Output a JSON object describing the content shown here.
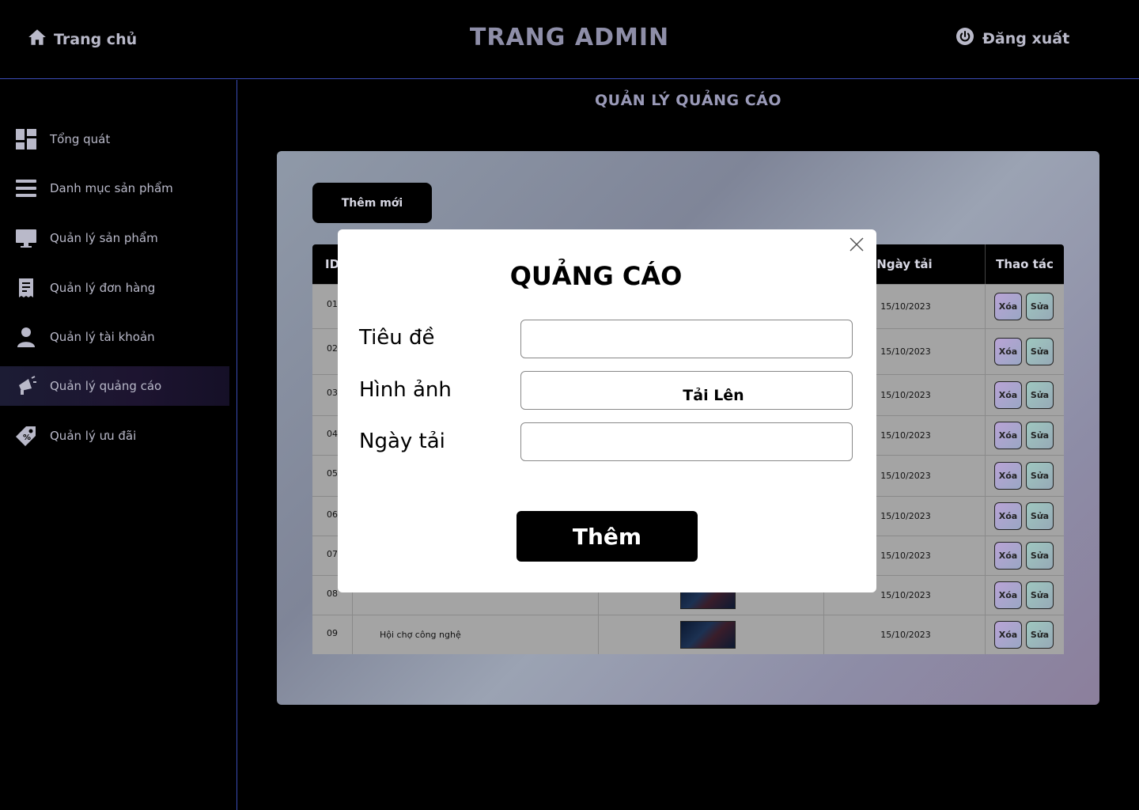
{
  "header": {
    "home_label": "Trang chủ",
    "title": "TRANG ADMIN",
    "logout_label": "Đăng xuất"
  },
  "sidebar": {
    "items": [
      {
        "label": "Tổng quát",
        "icon": "dashboard-icon"
      },
      {
        "label": "Danh mục sản phẩm",
        "icon": "menu-lines-icon"
      },
      {
        "label": "Quản lý sản phẩm",
        "icon": "monitor-icon"
      },
      {
        "label": "Quản lý đơn hàng",
        "icon": "receipt-icon"
      },
      {
        "label": "Quản lý tài khoản",
        "icon": "user-icon"
      },
      {
        "label": "Quản lý quảng cáo",
        "icon": "megaphone-icon",
        "active": true
      },
      {
        "label": "Quản lý ưu đãi",
        "icon": "tag-icon"
      }
    ]
  },
  "main": {
    "section_title": "QUẢN LÝ QUẢNG CÁO",
    "add_new_label": "Thêm mới",
    "table": {
      "headers": [
        "ID",
        "Ngày tải",
        "Thao tác"
      ],
      "delete_label": "Xóa",
      "edit_label": "Sửa",
      "rows": [
        {
          "id": "01",
          "title": "",
          "date": "15/10/2023"
        },
        {
          "id": "02",
          "title": "",
          "date": "15/10/2023"
        },
        {
          "id": "03",
          "title": "",
          "date": "15/10/2023"
        },
        {
          "id": "04",
          "title": "",
          "date": "15/10/2023"
        },
        {
          "id": "05",
          "title": "",
          "date": "15/10/2023"
        },
        {
          "id": "06",
          "title": "",
          "date": "15/10/2023"
        },
        {
          "id": "07",
          "title": "",
          "date": "15/10/2023"
        },
        {
          "id": "08",
          "title": "",
          "date": "15/10/2023"
        },
        {
          "id": "09",
          "title": "Hội chợ công nghệ",
          "date": "15/10/2023"
        }
      ]
    }
  },
  "modal": {
    "title": "QUẢNG CÁO",
    "fields": {
      "title_label": "Tiêu đề",
      "title_value": "",
      "image_label": "Hình ảnh",
      "upload_label": "Tải Lên",
      "date_label": "Ngày tải",
      "date_value": ""
    },
    "submit_label": "Thêm"
  },
  "colors": {
    "accent_line": "#3b4cb5",
    "background": "#000000",
    "panel": "#8f99a8"
  }
}
